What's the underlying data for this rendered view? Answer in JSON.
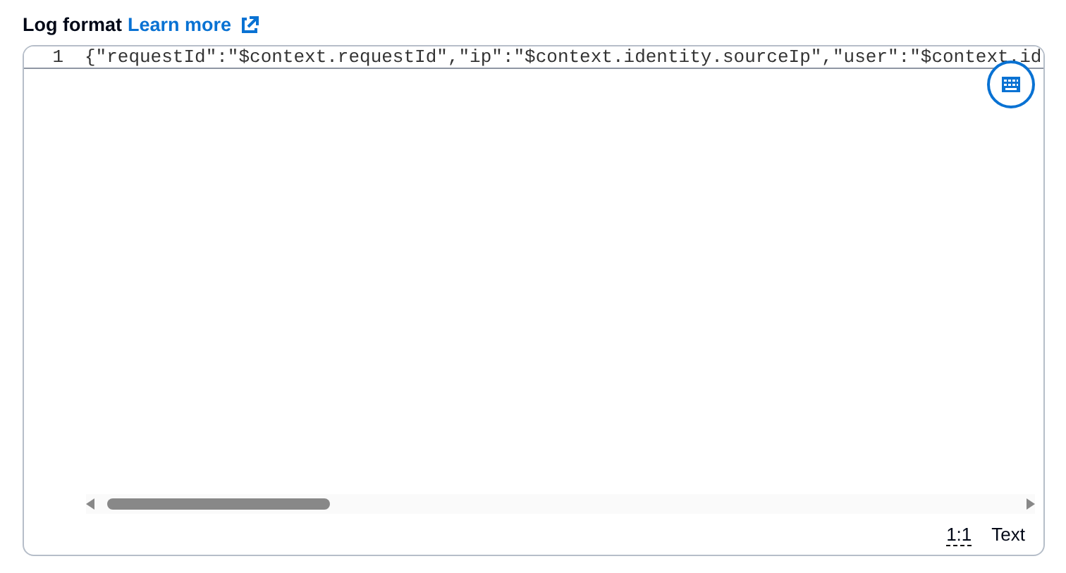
{
  "label": {
    "title": "Log format",
    "link": "Learn more"
  },
  "editor": {
    "lines": [
      {
        "number": "1",
        "code": "{\"requestId\":\"$context.requestId\",\"ip\":\"$context.identity.sourceIp\",\"user\":\"$context.id"
      }
    ],
    "status": {
      "position": "1:1",
      "mode": "Text"
    }
  }
}
